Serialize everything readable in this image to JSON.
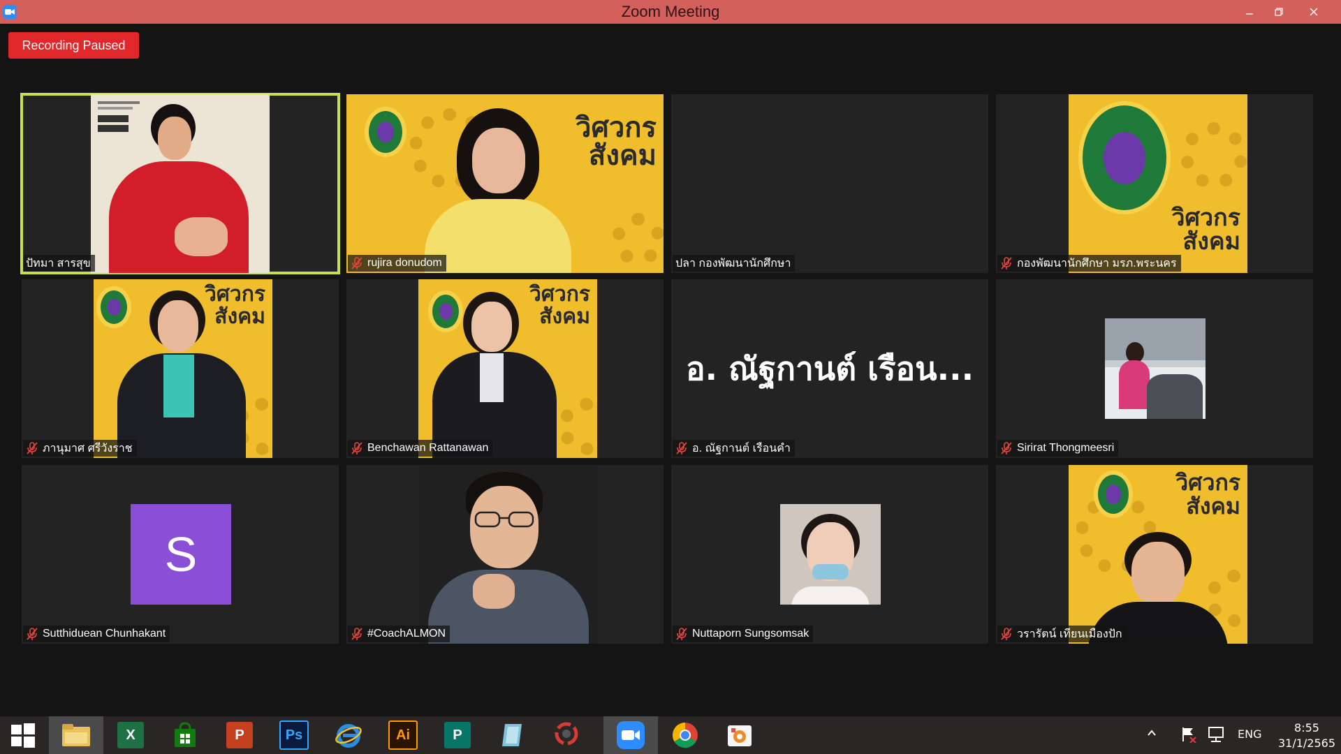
{
  "window": {
    "title": "Zoom Meeting",
    "titlebar_color": "#d4605c"
  },
  "recording": {
    "label": "Recording Paused",
    "color": "#e0272a"
  },
  "participants": [
    {
      "name": "ปัทมา สารสุข",
      "muted": false,
      "active_speaker": true,
      "view": "video-red"
    },
    {
      "name": "rujira donudom",
      "muted": true,
      "view": "poster-wide"
    },
    {
      "name": "ปลา กองพัฒนานักศึกษา",
      "muted": false,
      "view": "blank"
    },
    {
      "name": "กองพัฒนานักศึกษา มรภ.พระนคร",
      "muted": true,
      "view": "poster-logo"
    },
    {
      "name": "ภานุมาศ ศรีวังราช",
      "muted": true,
      "view": "poster-person"
    },
    {
      "name": "Benchawan Rattanawan",
      "muted": true,
      "view": "poster-person"
    },
    {
      "name": "อ. ณัฐกานต์ เรือนคำ",
      "display_name": "อ. ณัฐกานต์ เรือน...",
      "muted": true,
      "view": "name-only"
    },
    {
      "name": "Sirirat Thongmeesri",
      "muted": true,
      "view": "picture-snow"
    },
    {
      "name": "Sutthiduean Chunhakant",
      "muted": true,
      "view": "avatar",
      "avatar_letter": "S",
      "avatar_color": "#8a4fd6"
    },
    {
      "name": "#CoachALMON",
      "muted": true,
      "view": "photo-man"
    },
    {
      "name": "Nuttaporn Sungsomsak",
      "muted": true,
      "view": "picture-woman"
    },
    {
      "name": "วรารัตน์ เทียนเมืองปัก",
      "muted": true,
      "view": "poster-person"
    }
  ],
  "poster": {
    "brand_line1": "วิศวกร",
    "brand_line2": "สังคม",
    "accent": "#f0be2c"
  },
  "taskbar": {
    "apps": [
      "start",
      "file-explorer",
      "excel",
      "store",
      "powerpoint",
      "photoshop",
      "internet-explorer",
      "illustrator",
      "publisher",
      "notepad",
      "photoscape",
      "zoom",
      "chrome",
      "paint"
    ],
    "tile_labels": {
      "excel": "X",
      "powerpoint": "P",
      "photoshop": "Ps",
      "illustrator": "Ai",
      "publisher": "P"
    },
    "language": "ENG",
    "time": "8:55",
    "date": "31/1/2565"
  }
}
